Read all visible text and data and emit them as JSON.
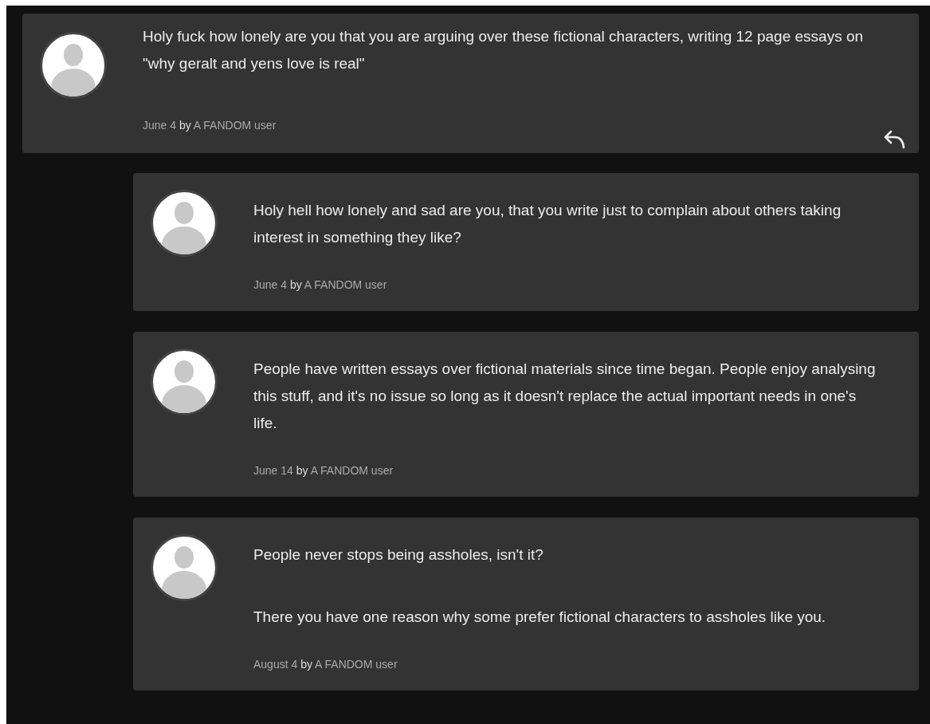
{
  "comment": {
    "body": [
      "Holy fuck how lonely are you that you are arguing over these fictional characters, writing 12 page essays on \"why geralt and yens love is real\""
    ],
    "meta": "June 4 **by** A FANDOM user"
  },
  "replies": [
    {
      "body": [
        "Holy hell how lonely and sad are you, that you write just to complain about others taking interest in something they like?"
      ],
      "meta": "June 4 **by** A FANDOM user"
    },
    {
      "body": [
        "People have written essays over fictional materials since time began. People enjoy analysing this stuff, and it's no issue so long as it doesn't replace the actual important needs in one's life."
      ],
      "meta": "June 14 **by** A FANDOM user"
    },
    {
      "body": [
        "People never stops being assholes, isn't it?",
        "There you have one reason why some prefer fictional characters to assholes like you."
      ],
      "meta": "August 4 **by** A FANDOM user"
    }
  ]
}
